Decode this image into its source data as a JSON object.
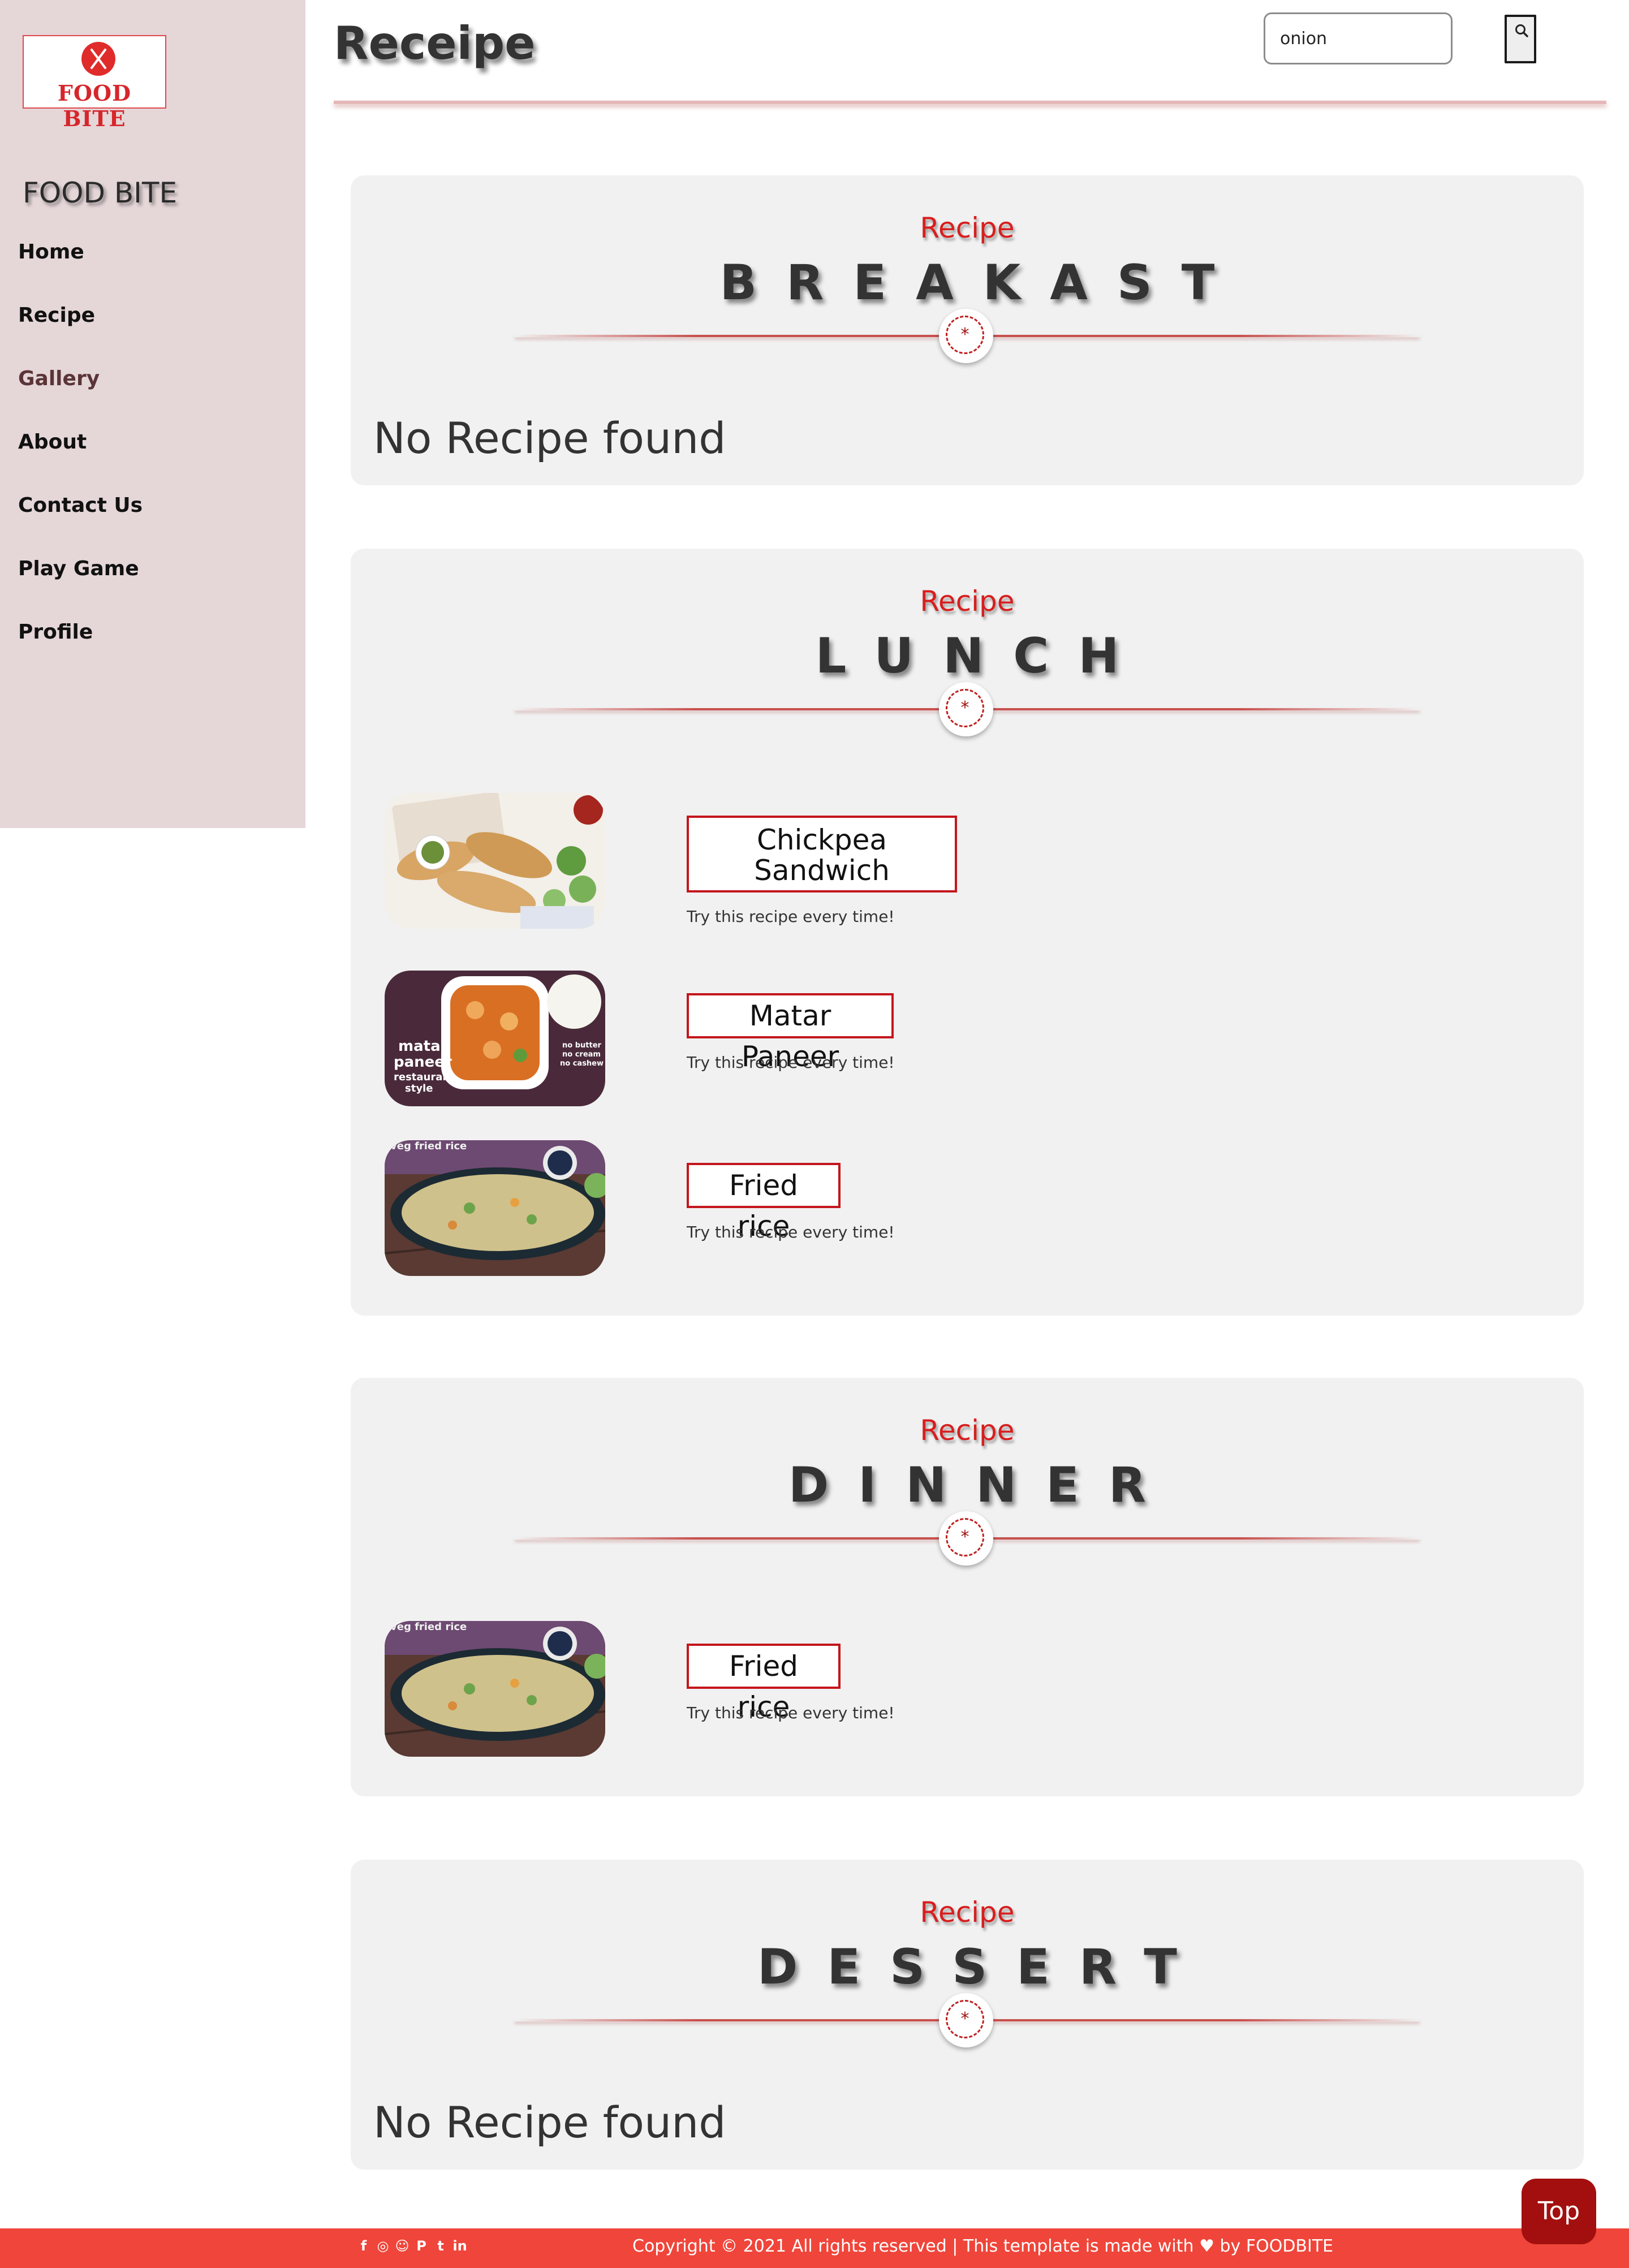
{
  "sidebar": {
    "logo_text": "FOOD BITE",
    "brand": "FOOD BITE",
    "items": [
      {
        "label": "Home"
      },
      {
        "label": "Recipe"
      },
      {
        "label": "Gallery"
      },
      {
        "label": "About"
      },
      {
        "label": "Contact Us"
      },
      {
        "label": "Play Game"
      },
      {
        "label": "Profile"
      }
    ]
  },
  "header": {
    "title": "Receipe",
    "search_value": "onion"
  },
  "sections": [
    {
      "kicker": "Recipe",
      "title": "BREAKAST",
      "empty_text": "No Recipe found"
    },
    {
      "kicker": "Recipe",
      "title": "LUNCH",
      "recipes": [
        {
          "name": "Chickpea Sandwich",
          "subtitle": "Try this recipe every time!"
        },
        {
          "name": "Matar Paneer",
          "subtitle": "Try this recipe every time!",
          "image_text": [
            "matar",
            "paneer",
            "restaurant",
            "style",
            "no butter",
            "no cream",
            "no cashew"
          ]
        },
        {
          "name": "Fried rice",
          "subtitle": "Try this recipe every time!",
          "image_text": "veg fried rice"
        }
      ]
    },
    {
      "kicker": "Recipe",
      "title": "DINNER",
      "recipes": [
        {
          "name": "Fried rice",
          "subtitle": "Try this recipe every time!",
          "image_text": "veg fried rice"
        }
      ]
    },
    {
      "kicker": "Recipe",
      "title": "DESSERT",
      "empty_text": "No Recipe found"
    }
  ],
  "footer": {
    "copyright": "Copyright © 2021 All rights reserved | This template is made with",
    "made_by": "by FOODBITE",
    "social_icons": [
      "facebook-icon",
      "instagram-icon",
      "snapchat-icon",
      "pinterest-icon",
      "twitter-icon",
      "linkedin-icon"
    ],
    "accent": "#f0453a"
  },
  "top_button": "Top",
  "colors": {
    "accent_red": "#d81e1e",
    "sidebar_bg": "#e5d6d8",
    "section_bg": "#f1f1f1",
    "top_button_bg": "#a30f0f"
  }
}
